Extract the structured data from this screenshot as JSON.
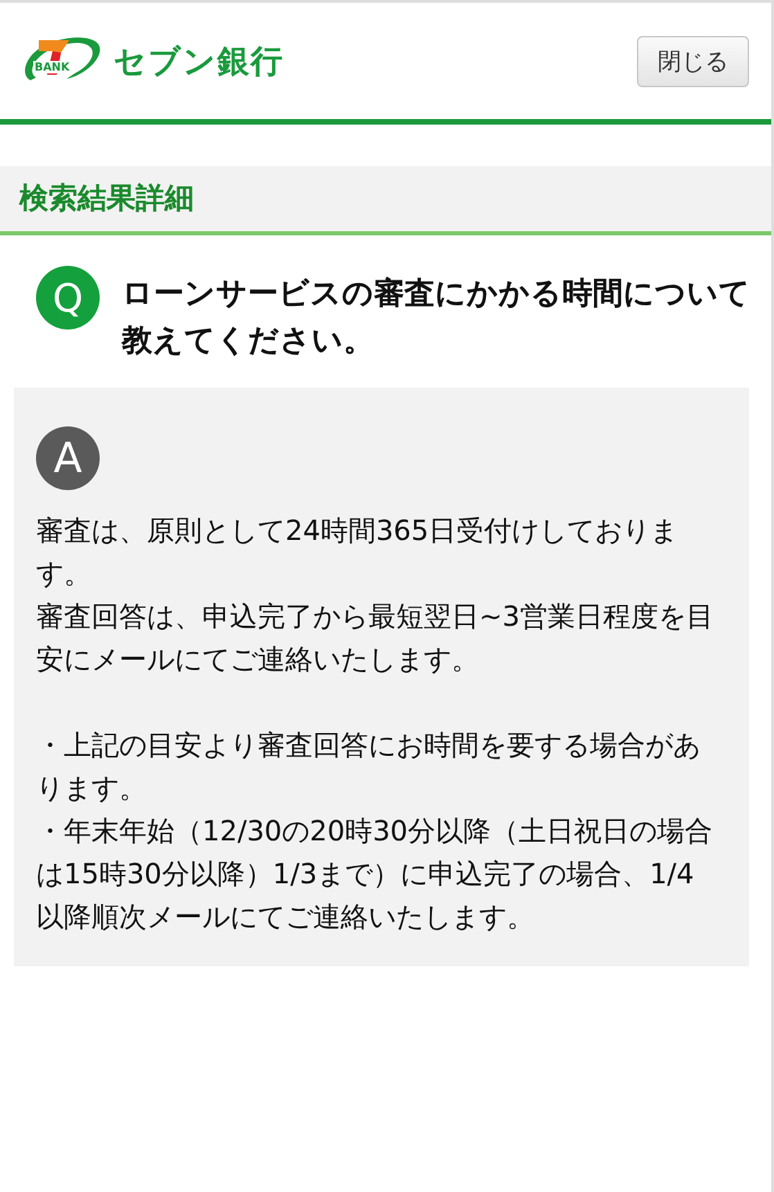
{
  "header": {
    "logo_badge": "BANK",
    "logo_text": "セブン銀行",
    "close_button": "閉じる"
  },
  "section_title": "検索結果詳細",
  "question": {
    "mark": "Q",
    "text": "ローンサービスの審査にかかる時間について教えてください。"
  },
  "answer": {
    "mark": "A",
    "blocks": [
      [
        "審査は、原則として24時間365日受付けしております。",
        "審査回答は、申込完了から最短翌日~3営業日程度を目安にメールにてご連絡いたします。"
      ],
      [
        "・上記の目安より審査回答にお時間を要する場合があります。",
        "・年末年始（12/30の20時30分以降（土日祝日の場合は15時30分以降）1/3まで）に申込完了の場合、1/4以降順次メールにてご連絡いたします。"
      ]
    ]
  }
}
